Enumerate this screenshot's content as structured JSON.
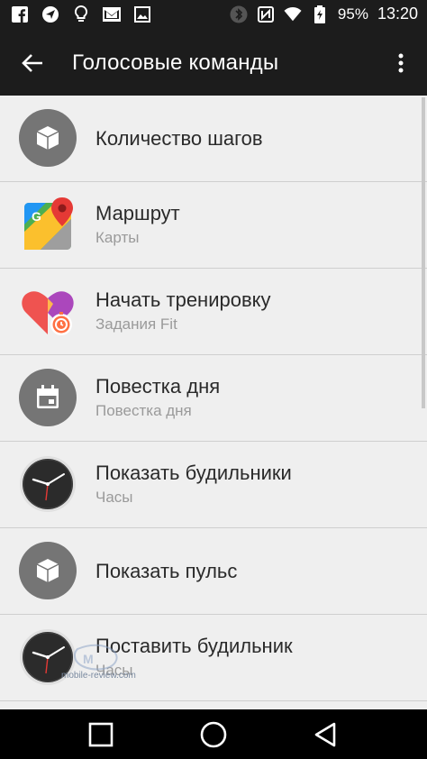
{
  "status_bar": {
    "battery": "95%",
    "time": "13:20",
    "left_icons": [
      "facebook-icon",
      "navigation-icon",
      "bulb-icon",
      "gmail-icon",
      "image-icon"
    ],
    "right_icons": [
      "bluetooth-icon",
      "nfc-icon",
      "wifi-icon",
      "battery-icon"
    ]
  },
  "toolbar": {
    "title": "Голосовые команды",
    "back_icon": "back-arrow-icon",
    "menu_icon": "more-vert-icon"
  },
  "commands": [
    {
      "label": "Количество шагов",
      "subtitle": "",
      "icon": "cube-icon"
    },
    {
      "label": "Маршрут",
      "subtitle": "Карты",
      "icon": "google-maps-icon"
    },
    {
      "label": "Начать тренировку",
      "subtitle": "Задания Fit",
      "icon": "google-fit-icon"
    },
    {
      "label": "Повестка дня",
      "subtitle": "Повестка дня",
      "icon": "calendar-icon"
    },
    {
      "label": "Показать будильники",
      "subtitle": "Часы",
      "icon": "clock-icon"
    },
    {
      "label": "Показать пульс",
      "subtitle": "",
      "icon": "cube-icon"
    },
    {
      "label": "Поставить будильник",
      "subtitle": "Часы",
      "icon": "clock-icon"
    }
  ],
  "watermark": "mobile-review.com",
  "colors": {
    "bar": "#1c1c1c",
    "background": "#efefef",
    "icon_circle": "#757575",
    "primary_text": "#2a2a2a",
    "secondary_text": "#9a9a9a"
  }
}
